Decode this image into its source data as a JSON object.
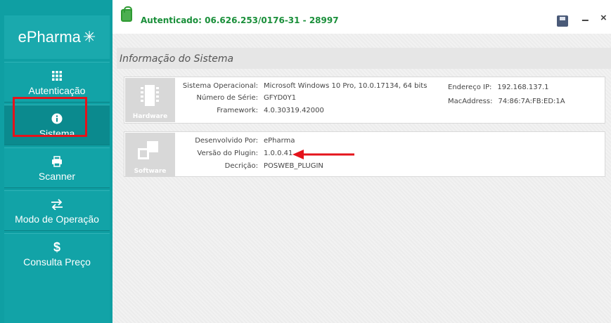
{
  "sidebar": {
    "logo": "ePharma",
    "items": [
      {
        "label": "Autenticação",
        "icon": "grid-icon"
      },
      {
        "label": "Sistema",
        "icon": "info-icon"
      },
      {
        "label": "Scanner",
        "icon": "printer-icon"
      },
      {
        "label": "Modo de Operação",
        "icon": "swap-arrows-icon"
      },
      {
        "label": "Consulta Preço",
        "icon": "dollar-icon"
      }
    ],
    "active_index": 1
  },
  "topbar": {
    "auth_status": "Autenticado: 06.626.253/0176-31 - 28997"
  },
  "main": {
    "section_title": "Informação do Sistema",
    "hardware": {
      "tile_label": "Hardware",
      "fields": [
        {
          "label": "Sistema Operacional:",
          "value": "Microsoft Windows 10 Pro, 10.0.17134, 64 bits"
        },
        {
          "label": "Número de Série:",
          "value": "GFYD0Y1"
        },
        {
          "label": "Framework:",
          "value": "4.0.30319.42000"
        }
      ],
      "network": [
        {
          "label": "Endereço IP:",
          "value": "192.168.137.1"
        },
        {
          "label": "MacAddress:",
          "value": "74:86:7A:FB:ED:1A"
        }
      ]
    },
    "software": {
      "tile_label": "Software",
      "fields": [
        {
          "label": "Desenvolvido Por:",
          "value": "ePharma"
        },
        {
          "label": "Versão do Plugin:",
          "value": "1.0.0.41"
        },
        {
          "label": "Decrição:",
          "value": "POSWEB_PLUGIN"
        }
      ]
    }
  },
  "colors": {
    "sidebar": "#0f9fa3",
    "accent_red": "#e4131b",
    "auth_green": "#1a8f3a"
  }
}
